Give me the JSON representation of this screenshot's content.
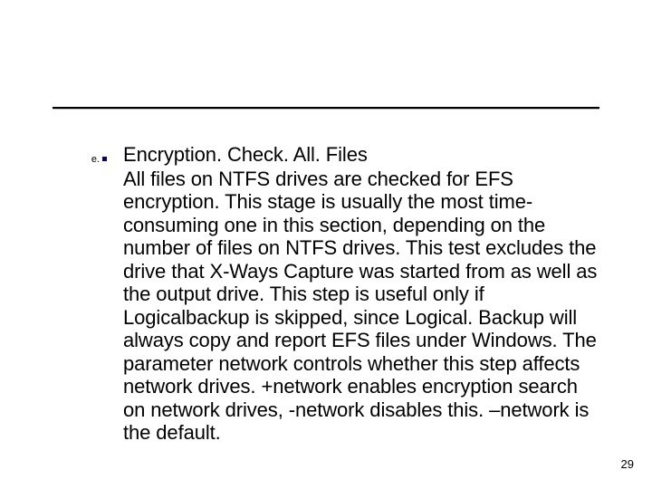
{
  "marker": "e.",
  "item": {
    "title": "Encryption. Check. All. Files",
    "body": "All files on NTFS drives are checked for EFS encryption. This stage is usually the most time-consuming one in this section, depending on the number of files on NTFS drives. This test excludes the drive that X-Ways Capture was started from as well as the output drive. This step is useful only if Logicalbackup is skipped, since Logical. Backup will always copy and report EFS files under Windows. The parameter network controls whether this step affects network drives. +network enables encryption search on network drives, -network disables this. –network is the default."
  },
  "page_number": "29"
}
